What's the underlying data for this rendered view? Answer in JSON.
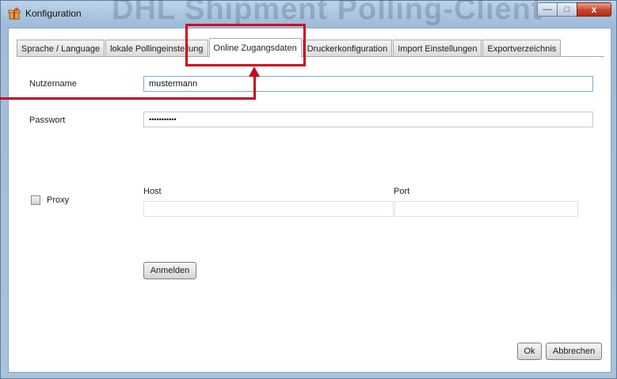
{
  "window": {
    "title": "Konfiguration",
    "background_watermark": "DHL Shipment Polling-Client",
    "icons": {
      "app": "app-package-icon",
      "minimize": "minimize-icon",
      "maximize": "maximize-icon",
      "close": "close-icon"
    },
    "glyphs": {
      "minimize": "—",
      "maximize": "□",
      "close": "x"
    }
  },
  "tabs": [
    {
      "label": "Sprache / Language",
      "active": false
    },
    {
      "label": "lokale Pollingeinstellung",
      "active": false
    },
    {
      "label": "Online Zugangsdaten",
      "active": true
    },
    {
      "label": "Druckerkonfiguration",
      "active": false
    },
    {
      "label": "Import Einstellungen",
      "active": false
    },
    {
      "label": "Exportverzeichnis",
      "active": false
    }
  ],
  "form": {
    "username": {
      "label": "Nutzername",
      "value": "mustermann"
    },
    "password": {
      "label": "Passwort",
      "value": "•••••••••••"
    },
    "proxy": {
      "label": "Proxy",
      "checked": false
    },
    "host": {
      "label": "Host",
      "value": ""
    },
    "port": {
      "label": "Port",
      "value": ""
    },
    "login_button": "Anmelden"
  },
  "footer": {
    "ok_label": "Ok",
    "cancel_label": "Abbrechen"
  },
  "annotation": {
    "color": "#d1071f",
    "target": "Online Zugangsdaten"
  }
}
